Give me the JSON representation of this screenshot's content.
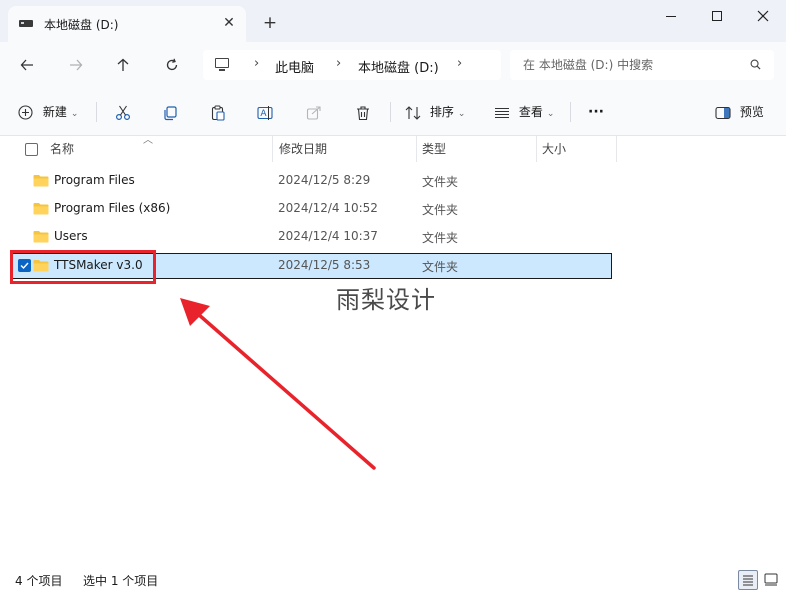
{
  "window": {
    "tab_title": "本地磁盘 (D:)",
    "tab_close": "✕",
    "new_tab": "+"
  },
  "addressbar": {
    "crumbs": [
      "此电脑",
      "本地磁盘 (D:)"
    ],
    "separator": "›"
  },
  "search": {
    "placeholder": "在 本地磁盘 (D:) 中搜索"
  },
  "commandbar": {
    "new_label": "新建",
    "sort_label": "排序",
    "view_label": "查看",
    "more_label": "···",
    "preview_label": "预览"
  },
  "columns": {
    "name": "名称",
    "modified": "修改日期",
    "type": "类型",
    "size": "大小"
  },
  "files": [
    {
      "name": "Program Files",
      "modified": "2024/12/5 8:29",
      "type": "文件夹",
      "selected": false
    },
    {
      "name": "Program Files (x86)",
      "modified": "2024/12/4 10:52",
      "type": "文件夹",
      "selected": false
    },
    {
      "name": "Users",
      "modified": "2024/12/4 10:37",
      "type": "文件夹",
      "selected": false
    },
    {
      "name": "TTSMaker v3.0",
      "modified": "2024/12/5 8:53",
      "type": "文件夹",
      "selected": true
    }
  ],
  "watermark": "雨梨设计",
  "statusbar": {
    "item_count": "4 个项目",
    "selected_count": "选中 1 个项目"
  },
  "colors": {
    "selection_bg": "#cce8ff",
    "annotation_red": "#e8232b",
    "folder_yellow": "#f5c542",
    "accent_blue": "#0a64c4"
  }
}
